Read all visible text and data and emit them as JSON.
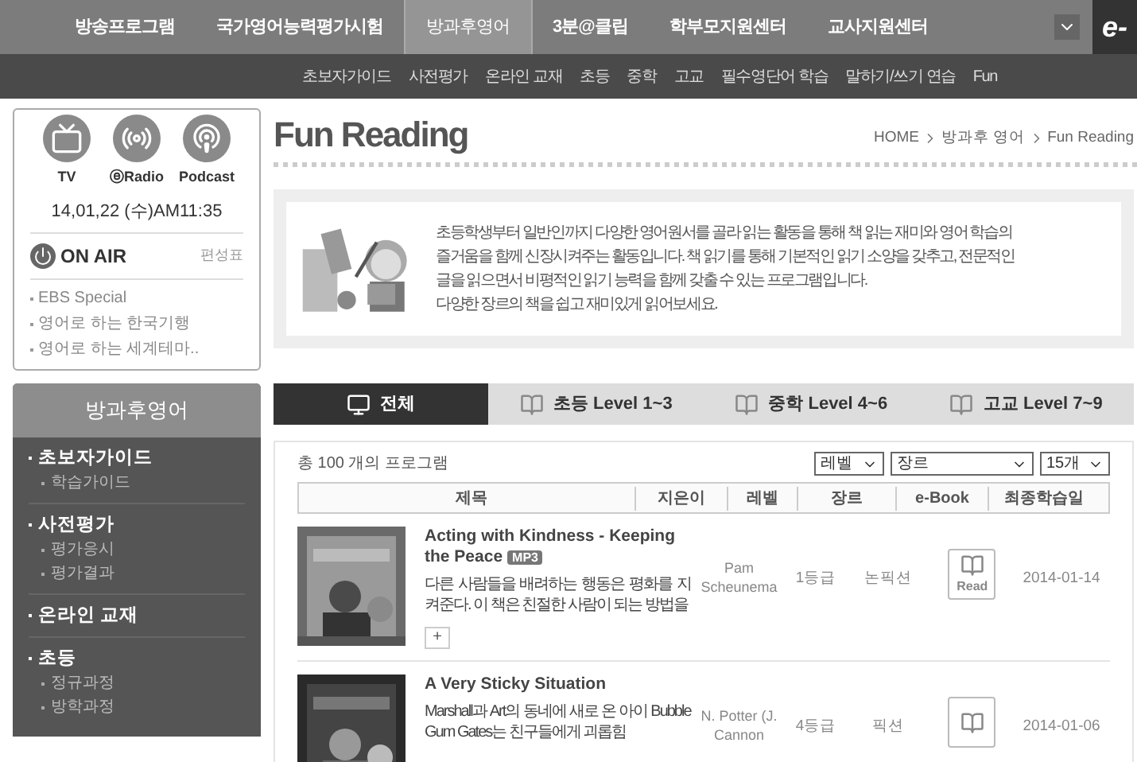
{
  "top_nav": {
    "items": [
      {
        "label": "방송프로그램",
        "selected": false
      },
      {
        "label": "국가영어능력평가시험",
        "selected": false
      },
      {
        "label": "방과후영어",
        "selected": true
      },
      {
        "label": "3분@클립",
        "selected": false
      },
      {
        "label": "학부모지원센터",
        "selected": false
      },
      {
        "label": "교사지원센터",
        "selected": false
      }
    ],
    "logo": "e-"
  },
  "sub_nav": {
    "items": [
      "초보자가이드",
      "사전평가",
      "온라인 교재",
      "초등",
      "중학",
      "고교",
      "필수영단어 학습",
      "말하기/쓰기 연습",
      "Fun"
    ]
  },
  "media_widget": {
    "channels": [
      {
        "kind": "tv",
        "label": "TV"
      },
      {
        "kind": "radio",
        "label": "ⓔRadio"
      },
      {
        "kind": "podcast",
        "label": "Podcast"
      }
    ],
    "datetime": "14,01,22 (수)AM11:35",
    "on_air": "ON AIR",
    "schedule": "편성표",
    "programs": [
      "EBS Special",
      "영어로 하는 한국기행",
      "영어로 하는 세계테마.."
    ]
  },
  "side_menu": {
    "title": "방과후영어",
    "sections": [
      {
        "label": "초보자가이드",
        "children": [
          {
            "label": "학습가이드"
          }
        ]
      },
      {
        "label": "사전평가",
        "children": [
          {
            "label": "평가응시"
          },
          {
            "label": "평가결과"
          }
        ]
      },
      {
        "label": "온라인 교재"
      },
      {
        "label": "초등",
        "children": [
          {
            "label": "정규과정"
          },
          {
            "label": "방학과정"
          }
        ]
      }
    ]
  },
  "page": {
    "title": "Fun Reading",
    "breadcrumb": [
      "HOME",
      "방과후 영어",
      "Fun Reading"
    ]
  },
  "intro": {
    "lines": [
      "초등학생부터 일반인까지 다양한 영어원서를 골라 읽는 활동을 통해 책 읽는 재미와 영어 학습의",
      "즐거움을 함께 신장시켜주는 활동입니다. 책 읽기를 통해 기본적인 읽기 소양을 갖추고, 전문적인",
      "글을 읽으면서 비평적인 읽기 능력을 함께 갖출 수 있는 프로그램입니다.",
      "다양한 장르의 책을 쉽고 재미있게 읽어보세요."
    ]
  },
  "tabs": [
    {
      "label": "전체",
      "kind": "all",
      "selected": true
    },
    {
      "label": "초등 Level 1~3",
      "kind": "book",
      "selected": false
    },
    {
      "label": "중학 Level 4~6",
      "kind": "book",
      "selected": false
    },
    {
      "label": "고교 Level 7~9",
      "kind": "book",
      "selected": false
    }
  ],
  "list": {
    "count": "총 100 개의 프로그램",
    "filters": [
      "레벨",
      "장르",
      "15개"
    ],
    "columns": [
      "제목",
      "지은이",
      "레벨",
      "장르",
      "e-Book",
      "최종학습일"
    ],
    "rows": [
      {
        "title": "Acting with Kindness - Keeping the Peace",
        "badge": "MP3",
        "summary": "다른 사람들을 배려하는 행동은 평화를 지켜준다. 이 책은 친절한 사람이 되는 방법을",
        "author": "Pam Scheunema",
        "level": "1등급",
        "genre": "논픽션",
        "ebook": "Read",
        "date": "2014-01-14",
        "expand": "+"
      },
      {
        "title": "A Very Sticky Situation",
        "summary": "Marshall과 Art의 동네에 새로 온 아이 Bubble Gum Gates는 친구들에게 괴롭힘",
        "author": "N. Potter (J. Cannon",
        "level": "4등급",
        "genre": "픽션",
        "date": "2014-01-06"
      }
    ]
  }
}
